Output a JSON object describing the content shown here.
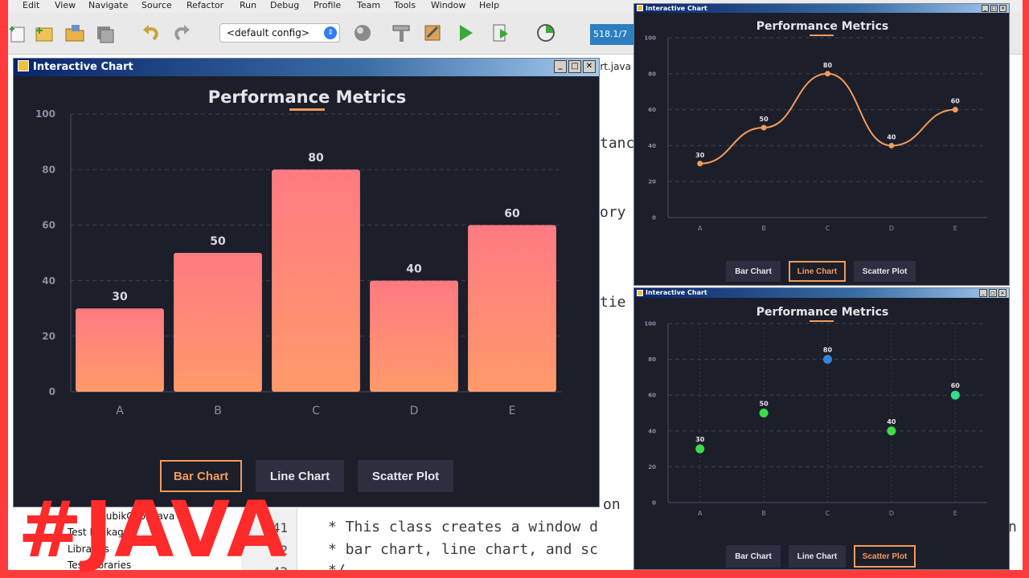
{
  "ide": {
    "menu": [
      "Edit",
      "View",
      "Navigate",
      "Source",
      "Refactor",
      "Run",
      "Debug",
      "Profile",
      "Team",
      "Tools",
      "Window",
      "Help"
    ],
    "config_select": "<default config>",
    "memory": "518.1/7",
    "editor_tab": "art.java",
    "code_fragments": [
      "tanc",
      "ory",
      "tie",
      "on"
    ],
    "gutter_numbers": [
      "41",
      "42",
      "43"
    ],
    "code_lines": [
      "* This class creates a window d",
      "* bar chart, line chart, and sc",
      "*/"
    ],
    "code_overflow": "n",
    "project_tree": [
      "RubikCube.java",
      "Test Packages",
      "Libraries",
      "Test Libraries"
    ]
  },
  "windows": [
    {
      "title": "Interactive Chart",
      "active_button": "Bar Chart"
    },
    {
      "title": "Interactive Chart",
      "active_button": "Line Chart"
    },
    {
      "title": "Interactive Chart",
      "active_button": "Scatter Plot"
    }
  ],
  "buttons": {
    "bar": "Bar Chart",
    "line": "Line Chart",
    "scatter": "Scatter Plot"
  },
  "window_controls": {
    "minimize": "_",
    "maximize": "□",
    "close": "✕"
  },
  "chart_data": [
    {
      "type": "bar",
      "title": "Performance Metrics",
      "categories": [
        "A",
        "B",
        "C",
        "D",
        "E"
      ],
      "values": [
        30,
        50,
        80,
        40,
        60
      ],
      "ylim": [
        0,
        100
      ],
      "yticks": [
        0,
        20,
        40,
        60,
        80,
        100
      ],
      "grid": true,
      "bar_gradient": [
        "#ff7a82",
        "#ff9a6a"
      ]
    },
    {
      "type": "line",
      "title": "Performance Metrics",
      "categories": [
        "A",
        "B",
        "C",
        "D",
        "E"
      ],
      "values": [
        30,
        50,
        80,
        40,
        60
      ],
      "ylim": [
        0,
        100
      ],
      "yticks": [
        0,
        20,
        40,
        60,
        80,
        100
      ],
      "grid": true,
      "line_color": "#f29c5c"
    },
    {
      "type": "scatter",
      "title": "Performance Metrics",
      "categories": [
        "A",
        "B",
        "C",
        "D",
        "E"
      ],
      "values": [
        30,
        50,
        80,
        40,
        60
      ],
      "ylim": [
        0,
        100
      ],
      "yticks": [
        0,
        20,
        40,
        60,
        80,
        100
      ],
      "grid": true,
      "point_colors": [
        "#3ddc4b",
        "#3ddc4b",
        "#2f86e0",
        "#3ddc4b",
        "#2fe08a"
      ]
    }
  ],
  "overlay": {
    "hashtag": "#JAVA"
  },
  "colors": {
    "accent": "#f29c5c",
    "chart_bg": "#1c1e2a",
    "frame": "#ff3b3b"
  }
}
